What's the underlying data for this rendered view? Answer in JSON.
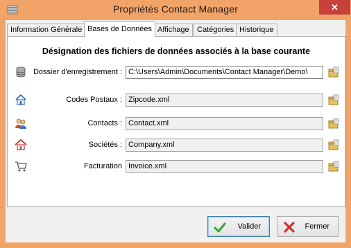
{
  "window": {
    "title": "Propriétés Contact Manager",
    "close_symbol": "✕",
    "accent_color": "#f2a368",
    "close_color": "#c7403a"
  },
  "tabs": [
    {
      "label": "Information Générale",
      "active": false
    },
    {
      "label": "Bases de Données",
      "active": true
    },
    {
      "label": "Affichage",
      "active": false
    },
    {
      "label": "Catégories",
      "active": false
    },
    {
      "label": "Historique",
      "active": false
    }
  ],
  "panel": {
    "heading": "Désignation des fichiers de données associés à la base courante",
    "rows": [
      {
        "icon": "database-icon",
        "label": "Dossier d'enregistrement :",
        "value": "C:\\Users\\Admin\\Documents\\Contact Manager\\Demo\\",
        "editable": true
      },
      {
        "icon": "house-icon",
        "label": "Codes Postaux :",
        "value": "Zipcode.xml",
        "editable": false
      },
      {
        "icon": "people-icon",
        "label": "Contacts :",
        "value": "Contact.xml",
        "editable": false
      },
      {
        "icon": "company-icon",
        "label": "Sociétés :",
        "value": "Company.xml",
        "editable": false
      },
      {
        "icon": "cart-icon",
        "label": "Facturation",
        "value": "Invoice.xml",
        "editable": false
      }
    ]
  },
  "buttons": {
    "ok_label": "Valider",
    "cancel_label": "Fermer"
  }
}
